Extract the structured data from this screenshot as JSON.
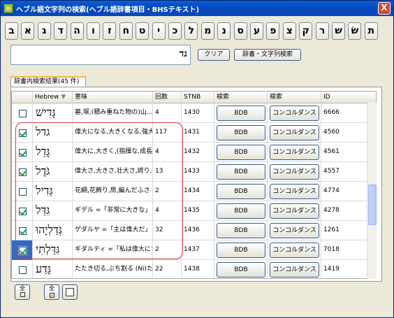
{
  "window": {
    "title": "ヘブル語文字列の検索(ヘブル語辞書項目・BHSテキスト)",
    "close_label": "X"
  },
  "letters": [
    "ב",
    "א",
    "ג",
    "ד",
    "ה",
    "ו",
    "ז",
    "ח",
    "ט",
    "י",
    "כ",
    "ל",
    "מ",
    "נ",
    "ס",
    "ע",
    "פ",
    "צ",
    "ק",
    "ר",
    "ש",
    "שׂ",
    "ת"
  ],
  "search": {
    "value": "גד",
    "clear_label": "クリア",
    "search_label": "辞書・文字列検索"
  },
  "results": {
    "tab_label": "辞書内検索結果(45 件)",
    "columns": [
      "Hebrew",
      "意味",
      "回数",
      "STNB",
      "検索",
      "検索",
      "ID"
    ],
    "rows": [
      {
        "checked": false,
        "hebrew": "גָּדִישׁ",
        "meaning": "墓,塚,(積み重ねた物の)山...",
        "count": "4",
        "stnb": "1430",
        "bdb": "BDB",
        "concord": "コンコルダンス",
        "id": "6666",
        "selected": false
      },
      {
        "checked": true,
        "hebrew": "גדל",
        "meaning": "偉大になる,大きくなる,強大に...",
        "count": "117",
        "stnb": "1431",
        "bdb": "BDB",
        "concord": "コンコルダンス",
        "id": "4560",
        "selected": false
      },
      {
        "checked": true,
        "hebrew": "גָּדֵל",
        "meaning": "偉大に,大きく,(指揮な,成長した",
        "count": "4",
        "stnb": "1432",
        "bdb": "BDB",
        "concord": "コンコルダンス",
        "id": "4561",
        "selected": false
      },
      {
        "checked": true,
        "hebrew": "גֹּדֶל",
        "meaning": "偉大さ,大きさ,壮大さ,誇り,傲...",
        "count": "13",
        "stnb": "1433",
        "bdb": "BDB",
        "concord": "コンコルダンス",
        "id": "4557",
        "selected": false
      },
      {
        "checked": false,
        "hebrew": "גְּדִיל",
        "meaning": "花綱,花飾り,房,編んだふさ",
        "count": "2",
        "stnb": "1434",
        "bdb": "BDB",
        "concord": "コンコルダンス",
        "id": "4774",
        "selected": false
      },
      {
        "checked": true,
        "hebrew": "גִּדֵּל",
        "meaning": "ギデル =「非常に大きな」",
        "count": "4",
        "stnb": "1435",
        "bdb": "BDB",
        "concord": "コンコルダンス",
        "id": "4278",
        "selected": false
      },
      {
        "checked": true,
        "hebrew": "גְּדַלְיָהוּ",
        "meaning": "ゲダルヤ =「主は偉大だ」",
        "count": "32",
        "stnb": "1436",
        "bdb": "BDB",
        "concord": "コンコルダンス",
        "id": "1261",
        "selected": false
      },
      {
        "checked": true,
        "hebrew": "גִּדַּלְתִּי",
        "meaning": "ギダルティ =「私は偉大にする」",
        "count": "2",
        "stnb": "1437",
        "bdb": "BDB",
        "concord": "コンコルダンス",
        "id": "7018",
        "selected": true
      },
      {
        "checked": false,
        "hebrew": "גָּדַע",
        "meaning": "たたき切る,ぶち割る (Ni)たた...",
        "count": "22",
        "stnb": "1438",
        "bdb": "BDB",
        "concord": "コンコルダンス",
        "id": "1419",
        "selected": false
      }
    ]
  },
  "bottom_buttons": [
    "全",
    "全",
    ""
  ],
  "colors": {
    "highlight": "#d63a3a",
    "checkmark": "#21a121",
    "title_bar": "#0248c0"
  }
}
